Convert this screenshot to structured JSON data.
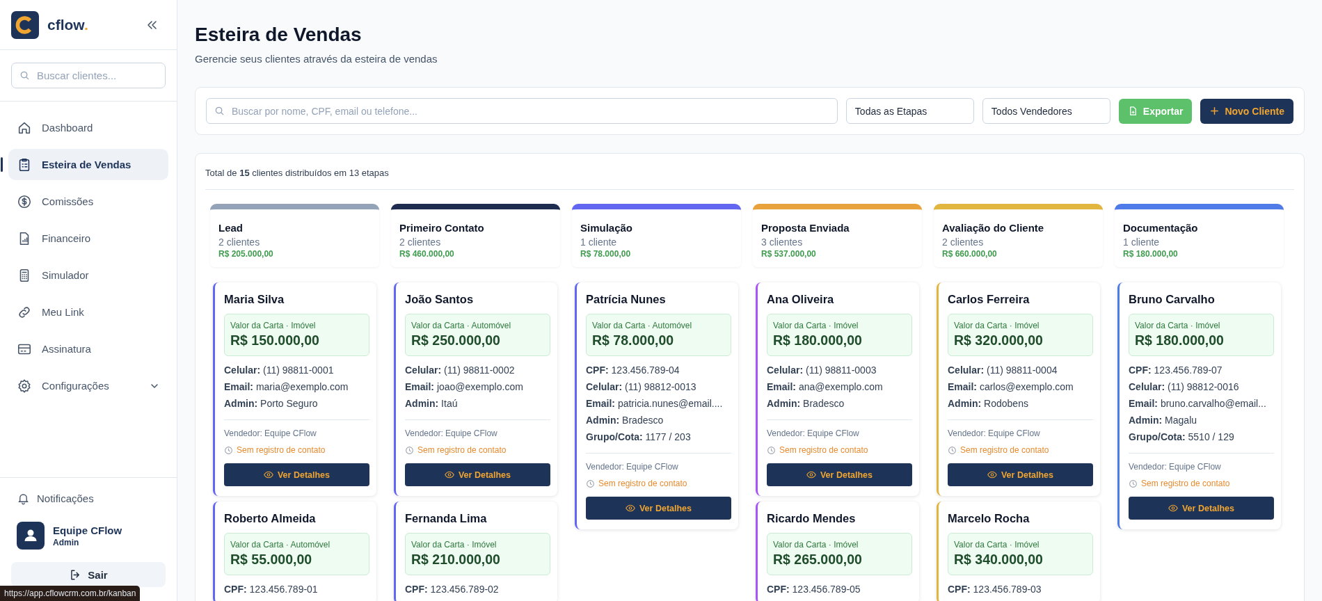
{
  "sidebar": {
    "logo_text": "cflow",
    "logo_dot": ".",
    "search_placeholder": "Buscar clientes...",
    "nav": [
      {
        "label": "Dashboard",
        "kind": "home",
        "selected": false,
        "has_submenu": false
      },
      {
        "label": "Esteira de Vendas",
        "kind": "clipboard",
        "selected": true,
        "has_submenu": false
      },
      {
        "label": "Comissões",
        "kind": "dollar",
        "selected": false,
        "has_submenu": false
      },
      {
        "label": "Financeiro",
        "kind": "file-chart",
        "selected": false,
        "has_submenu": false
      },
      {
        "label": "Simulador",
        "kind": "calculator",
        "selected": false,
        "has_submenu": false
      },
      {
        "label": "Meu Link",
        "kind": "link",
        "selected": false,
        "has_submenu": false
      },
      {
        "label": "Assinatura",
        "kind": "card",
        "selected": false,
        "has_submenu": false
      },
      {
        "label": "Configurações",
        "kind": "gear",
        "selected": false,
        "has_submenu": true
      }
    ],
    "notifications": "Notificações",
    "user": {
      "name": "Equipe CFlow",
      "role": "Admin"
    },
    "logout": "Sair"
  },
  "header": {
    "title": "Esteira de Vendas",
    "subtitle": "Gerencie seus clientes através da esteira de vendas"
  },
  "toolbar": {
    "search_placeholder": "Buscar por nome, CPF, email ou telefone...",
    "filters": [
      "Todas as Etapas",
      "Todos Vendedores"
    ],
    "export": "Exportar",
    "new_client": "Novo Cliente"
  },
  "summary": "Total de **15** clientes distribuídos em 13 etapas",
  "columns": [
    {
      "title": "Lead",
      "count": "2 clientes",
      "total": "R$ 205.000,00",
      "color": "#94a3b8",
      "cards": [
        {
          "name": "Maria Silva",
          "color": "#6366f1",
          "category": "Valor da Carta · Imóvel",
          "amount": "R$ 150.000,00",
          "fields": [
            {
              "label": "Celular:",
              "value": "(11) 98811-0001"
            },
            {
              "label": "Email:",
              "value": "maria@exemplo.com"
            },
            {
              "label": "Admin:",
              "value": "Porto Seguro"
            }
          ],
          "seller": "Vendedor: Equipe CFlow",
          "contact": "Sem registro de contato",
          "action": "Ver Detalhes"
        },
        {
          "name": "Roberto Almeida",
          "color": "#6366f1",
          "category": "Valor da Carta · Automóvel",
          "amount": "R$ 55.000,00",
          "fields": [
            {
              "label": "CPF:",
              "value": "123.456.789-01"
            }
          ]
        }
      ]
    },
    {
      "title": "Primeiro Contato",
      "count": "2 clientes",
      "total": "R$ 460.000,00",
      "color": "#1e2d4f",
      "cards": [
        {
          "name": "João Santos",
          "color": "#6366f1",
          "category": "Valor da Carta · Automóvel",
          "amount": "R$ 250.000,00",
          "fields": [
            {
              "label": "Celular:",
              "value": "(11) 98811-0002"
            },
            {
              "label": "Email:",
              "value": "joao@exemplo.com"
            },
            {
              "label": "Admin:",
              "value": "Itaú"
            }
          ],
          "seller": "Vendedor: Equipe CFlow",
          "contact": "Sem registro de contato",
          "action": "Ver Detalhes"
        },
        {
          "name": "Fernanda Lima",
          "color": "#6366f1",
          "category": "Valor da Carta · Imóvel",
          "amount": "R$ 210.000,00",
          "fields": [
            {
              "label": "CPF:",
              "value": "123.456.789-02"
            }
          ]
        }
      ]
    },
    {
      "title": "Simulação",
      "count": "1 cliente",
      "total": "R$ 78.000,00",
      "color": "#6366f1",
      "cards": [
        {
          "name": "Patrícia Nunes",
          "color": "#6366f1",
          "category": "Valor da Carta · Automóvel",
          "amount": "R$ 78.000,00",
          "fields": [
            {
              "label": "CPF:",
              "value": "123.456.789-04"
            },
            {
              "label": "Celular:",
              "value": "(11) 98812-0013"
            },
            {
              "label": "Email:",
              "value": "patricia.nunes@email...."
            },
            {
              "label": "Admin:",
              "value": "Bradesco"
            },
            {
              "label": "Grupo/Cota:",
              "value": "1177 / 203"
            }
          ],
          "seller": "Vendedor: Equipe CFlow",
          "contact": "Sem registro de contato",
          "action": "Ver Detalhes"
        }
      ]
    },
    {
      "title": "Proposta Enviada",
      "count": "3 clientes",
      "total": "R$ 537.000,00",
      "color": "#e9a23b",
      "cards": [
        {
          "name": "Ana Oliveira",
          "color": "#a855f7",
          "category": "Valor da Carta · Imóvel",
          "amount": "R$ 180.000,00",
          "fields": [
            {
              "label": "Celular:",
              "value": "(11) 98811-0003"
            },
            {
              "label": "Email:",
              "value": "ana@exemplo.com"
            },
            {
              "label": "Admin:",
              "value": "Bradesco"
            }
          ],
          "seller": "Vendedor: Equipe CFlow",
          "contact": "Sem registro de contato",
          "action": "Ver Detalhes"
        },
        {
          "name": "Ricardo Mendes",
          "color": "#a855f7",
          "category": "Valor da Carta · Imóvel",
          "amount": "R$ 265.000,00",
          "fields": [
            {
              "label": "CPF:",
              "value": "123.456.789-05"
            }
          ]
        }
      ]
    },
    {
      "title": "Avaliação do Cliente",
      "count": "2 clientes",
      "total": "R$ 660.000,00",
      "color": "#e2b53f",
      "cards": [
        {
          "name": "Carlos Ferreira",
          "color": "#e2b53f",
          "category": "Valor da Carta · Imóvel",
          "amount": "R$ 320.000,00",
          "fields": [
            {
              "label": "Celular:",
              "value": "(11) 98811-0004"
            },
            {
              "label": "Email:",
              "value": "carlos@exemplo.com"
            },
            {
              "label": "Admin:",
              "value": "Rodobens"
            }
          ],
          "seller": "Vendedor: Equipe CFlow",
          "contact": "Sem registro de contato",
          "action": "Ver Detalhes"
        },
        {
          "name": "Marcelo Rocha",
          "color": "#e2b53f",
          "category": "Valor da Carta · Imóvel",
          "amount": "R$ 340.000,00",
          "fields": [
            {
              "label": "CPF:",
              "value": "123.456.789-03"
            }
          ]
        }
      ]
    },
    {
      "title": "Documentação",
      "count": "1 cliente",
      "total": "R$ 180.000,00",
      "color": "#4f7be8",
      "cards": [
        {
          "name": "Bruno Carvalho",
          "color": "#4f7be8",
          "category": "Valor da Carta · Imóvel",
          "amount": "R$ 180.000,00",
          "fields": [
            {
              "label": "CPF:",
              "value": "123.456.789-07"
            },
            {
              "label": "Celular:",
              "value": "(11) 98812-0016"
            },
            {
              "label": "Email:",
              "value": "bruno.carvalho@email..."
            },
            {
              "label": "Admin:",
              "value": "Magalu"
            },
            {
              "label": "Grupo/Cota:",
              "value": "5510 / 129"
            }
          ],
          "seller": "Vendedor: Equipe CFlow",
          "contact": "Sem registro de contato",
          "action": "Ver Detalhes"
        }
      ]
    }
  ],
  "status_url": "https://app.cflowcrm.com.br/kanban"
}
